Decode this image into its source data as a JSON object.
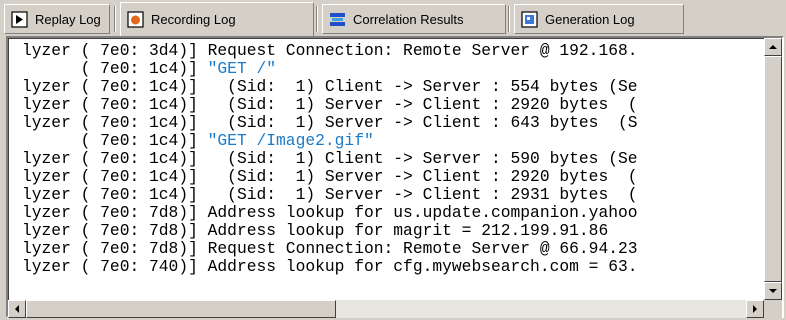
{
  "tabs": [
    {
      "label": "Replay Log",
      "icon": "replay-icon"
    },
    {
      "label": "Recording Log",
      "icon": "recording-icon"
    },
    {
      "label": "Correlation Results",
      "icon": "correlation-icon"
    },
    {
      "label": "Generation Log",
      "icon": "generation-icon"
    }
  ],
  "active_tab": "Recording Log",
  "log_lines": [
    {
      "pre": "lyzer ( 7e0: 3d4)] ",
      "text": "Request Connection: Remote Server @ 192.168.",
      "highlight": false
    },
    {
      "pre": "      ( 7e0: 1c4)] ",
      "text": "\"GET /\"",
      "highlight": true
    },
    {
      "pre": "lyzer ( 7e0: 1c4)] ",
      "text": "  (Sid:  1) Client -> Server : 554 bytes (Se",
      "highlight": false
    },
    {
      "pre": "lyzer ( 7e0: 1c4)] ",
      "text": "  (Sid:  1) Server -> Client : 2920 bytes  (",
      "highlight": false
    },
    {
      "pre": "lyzer ( 7e0: 1c4)] ",
      "text": "  (Sid:  1) Server -> Client : 643 bytes  (S",
      "highlight": false
    },
    {
      "pre": "      ( 7e0: 1c4)] ",
      "text": "\"GET /Image2.gif\"",
      "highlight": true
    },
    {
      "pre": "lyzer ( 7e0: 1c4)] ",
      "text": "  (Sid:  1) Client -> Server : 590 bytes (Se",
      "highlight": false
    },
    {
      "pre": "lyzer ( 7e0: 1c4)] ",
      "text": "  (Sid:  1) Server -> Client : 2920 bytes  (",
      "highlight": false
    },
    {
      "pre": "lyzer ( 7e0: 1c4)] ",
      "text": "  (Sid:  1) Server -> Client : 2931 bytes  (",
      "highlight": false
    },
    {
      "pre": "lyzer ( 7e0: 7d8)] ",
      "text": "Address lookup for us.update.companion.yahoo",
      "highlight": false
    },
    {
      "pre": "lyzer ( 7e0: 7d8)] ",
      "text": "Address lookup for magrit = 212.199.91.86",
      "highlight": false
    },
    {
      "pre": "lyzer ( 7e0: 7d8)] ",
      "text": "Request Connection: Remote Server @ 66.94.23",
      "highlight": false
    },
    {
      "pre": "lyzer ( 7e0: 740)] ",
      "text": "Address lookup for cfg.mywebsearch.com = 63.",
      "highlight": false
    }
  ],
  "colors": {
    "highlight_text": "#1b7bc8",
    "chrome": "#d4d0c8",
    "recording_icon": "#e8661a",
    "correlation_icon": "#2050c8"
  }
}
